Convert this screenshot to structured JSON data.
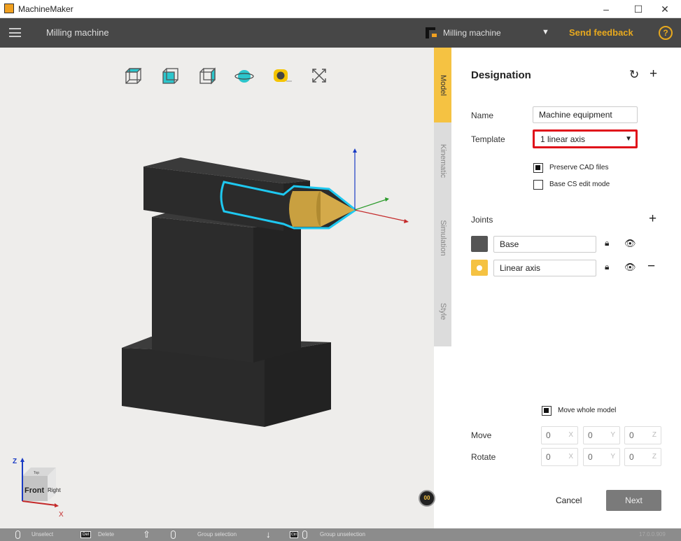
{
  "window": {
    "title": "MachineMaker",
    "minimize": "–",
    "maximize": "☐",
    "close": "✕"
  },
  "header": {
    "title": "Milling machine",
    "project_select": "Milling machine",
    "send_feedback": "Send feedback",
    "help": "?",
    "accent": "#e8a91e"
  },
  "toolbar": {
    "icons": [
      "view-top-icon",
      "view-front-icon",
      "view-right-icon",
      "orbit-icon",
      "measure-tape-icon",
      "fit-view-icon"
    ]
  },
  "view_cube": {
    "front": "Front",
    "right": "Right",
    "top": "Top",
    "z": "Z",
    "x": "X"
  },
  "viewport_button": "00",
  "side_tabs": [
    {
      "label": "Model",
      "active": true
    },
    {
      "label": "Kinematic"
    },
    {
      "label": "Simulation"
    },
    {
      "label": "Style"
    }
  ],
  "panel": {
    "title": "Designation",
    "name_label": "Name",
    "name_value": "Machine equipment",
    "template_label": "Template",
    "template_value": "1 linear axis",
    "preserve_cad": {
      "label": "Preserve CAD files",
      "checked": true
    },
    "base_cs": {
      "label": "Base CS edit mode",
      "checked": false
    },
    "joints_label": "Joints",
    "joints": [
      {
        "name": "Base",
        "color": "#555555"
      },
      {
        "name": "Linear axis",
        "color": "#f5c242"
      }
    ],
    "move_whole": {
      "label": "Move whole model",
      "checked": true
    },
    "move_label": "Move",
    "rotate_label": "Rotate",
    "move": {
      "x": "0",
      "y": "0",
      "z": "0"
    },
    "rotate": {
      "x": "0",
      "y": "0",
      "z": "0"
    },
    "axis_x": "X",
    "axis_y": "Y",
    "axis_z": "Z",
    "cancel": "Cancel",
    "next": "Next"
  },
  "status": {
    "unselect": "Unselect",
    "delete_key": "Del",
    "delete": "Delete",
    "shift_key": "⇧",
    "group_selection": "Group selection",
    "ctrl_key": "Ctrl",
    "group_unselection": "Group unselection",
    "version": "17.0.0.909"
  }
}
